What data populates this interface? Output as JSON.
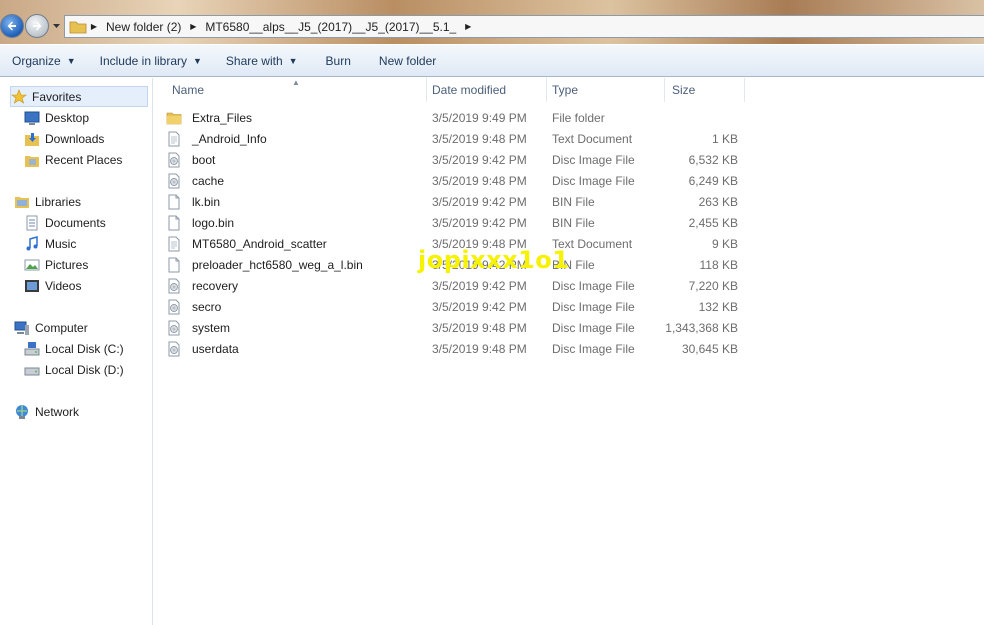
{
  "address": {
    "crumbs": [
      "New folder (2)",
      "MT6580__alps__J5_(2017)__J5_(2017)__5.1_"
    ]
  },
  "toolbar": {
    "organize": "Organize",
    "include_in_library": "Include in library",
    "share_with": "Share with",
    "burn": "Burn",
    "new_folder": "New folder"
  },
  "nav": {
    "favorites": "Favorites",
    "desktop": "Desktop",
    "downloads": "Downloads",
    "recent_places": "Recent Places",
    "libraries": "Libraries",
    "documents": "Documents",
    "music": "Music",
    "pictures": "Pictures",
    "videos": "Videos",
    "computer": "Computer",
    "local_disk_c": "Local Disk (C:)",
    "local_disk_d": "Local Disk (D:)",
    "network": "Network"
  },
  "columns": {
    "name": "Name",
    "date_modified": "Date modified",
    "type": "Type",
    "size": "Size"
  },
  "files": [
    {
      "name": "Extra_Files",
      "date": "3/5/2019 9:49 PM",
      "type": "File folder",
      "size": "",
      "icon": "folder-icon"
    },
    {
      "name": "_Android_Info",
      "date": "3/5/2019 9:48 PM",
      "type": "Text Document",
      "size": "1 KB",
      "icon": "text-document-icon"
    },
    {
      "name": "boot",
      "date": "3/5/2019 9:42 PM",
      "type": "Disc Image File",
      "size": "6,532 KB",
      "icon": "disc-image-icon"
    },
    {
      "name": "cache",
      "date": "3/5/2019 9:48 PM",
      "type": "Disc Image File",
      "size": "6,249 KB",
      "icon": "disc-image-icon"
    },
    {
      "name": "lk.bin",
      "date": "3/5/2019 9:42 PM",
      "type": "BIN File",
      "size": "263 KB",
      "icon": "file-icon"
    },
    {
      "name": "logo.bin",
      "date": "3/5/2019 9:42 PM",
      "type": "BIN File",
      "size": "2,455 KB",
      "icon": "file-icon"
    },
    {
      "name": "MT6580_Android_scatter",
      "date": "3/5/2019 9:48 PM",
      "type": "Text Document",
      "size": "9 KB",
      "icon": "text-document-icon"
    },
    {
      "name": "preloader_hct6580_weg_a_l.bin",
      "date": "3/5/2019 9:42 PM",
      "type": "BIN File",
      "size": "118 KB",
      "icon": "file-icon"
    },
    {
      "name": "recovery",
      "date": "3/5/2019 9:42 PM",
      "type": "Disc Image File",
      "size": "7,220 KB",
      "icon": "disc-image-icon"
    },
    {
      "name": "secro",
      "date": "3/5/2019 9:42 PM",
      "type": "Disc Image File",
      "size": "132 KB",
      "icon": "disc-image-icon"
    },
    {
      "name": "system",
      "date": "3/5/2019 9:48 PM",
      "type": "Disc Image File",
      "size": "1,343,368 KB",
      "icon": "disc-image-icon"
    },
    {
      "name": "userdata",
      "date": "3/5/2019 9:48 PM",
      "type": "Disc Image File",
      "size": "30,645 KB",
      "icon": "disc-image-icon"
    }
  ],
  "watermark": "jopixxx1o1",
  "colors": {
    "toolbar_text": "#1e395b",
    "watermark": "#f6f200",
    "folder": "#e8c153"
  }
}
